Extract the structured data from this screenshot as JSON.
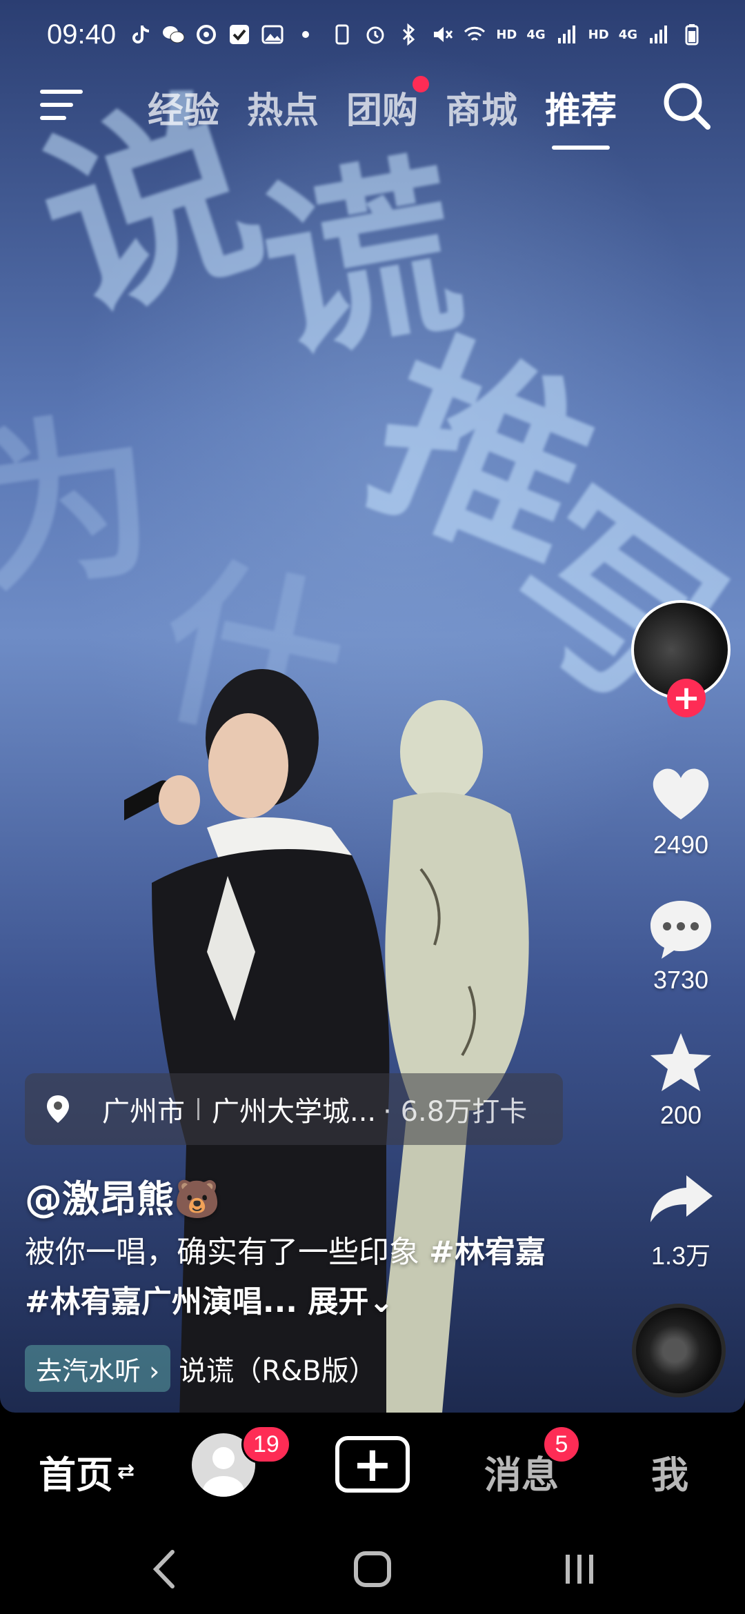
{
  "status_bar": {
    "time": "09:40",
    "right_labels": [
      "HD",
      "4G",
      "HD",
      "4G"
    ]
  },
  "top_nav": {
    "tabs": [
      {
        "label": "经验",
        "active": false,
        "badge": false
      },
      {
        "label": "热点",
        "active": false,
        "badge": false
      },
      {
        "label": "团购",
        "active": false,
        "badge": true
      },
      {
        "label": "商城",
        "active": false,
        "badge": false
      },
      {
        "label": "推荐",
        "active": true,
        "badge": false
      }
    ]
  },
  "rail": {
    "like_count": "2490",
    "comment_count": "3730",
    "favorite_count": "200",
    "share_count": "1.3万"
  },
  "location": {
    "city": "广州市",
    "place": "广州大学城...",
    "checkins": "· 6.8万打卡"
  },
  "post": {
    "author": "@激昂熊🐻",
    "caption_text": "被你一唱，确实有了一些印象 ",
    "tag1": "#林宥嘉",
    "tag2": " #林宥嘉广州演唱...",
    "expand_label": " 展开⌄"
  },
  "music": {
    "qishui_label": "去汽水听 ›",
    "title": "说谎（R&B版）"
  },
  "bottom_nav": {
    "home_label": "首页",
    "home_switch": "⇄",
    "friends_badge": "19",
    "messages_label": "消息",
    "messages_badge": "5",
    "me_label": "我"
  },
  "colors": {
    "accent": "#fe2c55",
    "background": "#000000"
  }
}
